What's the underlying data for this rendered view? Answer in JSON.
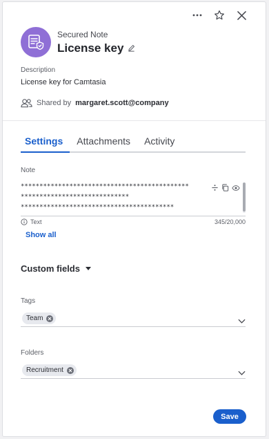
{
  "header": {
    "type_label": "Secured Note",
    "title": "License key",
    "avatar_color": "#8f6fd6"
  },
  "top_actions": [
    "more-icon",
    "star-icon",
    "close-icon"
  ],
  "description": {
    "label": "Description",
    "value": "License key for Camtasia"
  },
  "shared": {
    "prefix": "Shared by",
    "user": "margaret.scott@company"
  },
  "tabs": [
    {
      "label": "Settings",
      "active": true
    },
    {
      "label": "Attachments",
      "active": false
    },
    {
      "label": "Activity",
      "active": false
    }
  ],
  "note": {
    "label": "Note",
    "lines": [
      "*********************************************",
      "*****************************",
      "*****************************************"
    ],
    "format": "Text",
    "count": "345/20,000",
    "show_all": "Show all"
  },
  "custom_fields": {
    "label": "Custom fields"
  },
  "tags": {
    "label": "Tags",
    "chips": [
      "Team"
    ]
  },
  "folders": {
    "label": "Folders",
    "chips": [
      "Recruitment"
    ]
  },
  "save_label": "Save",
  "colors": {
    "accent": "#1a5fcc"
  }
}
